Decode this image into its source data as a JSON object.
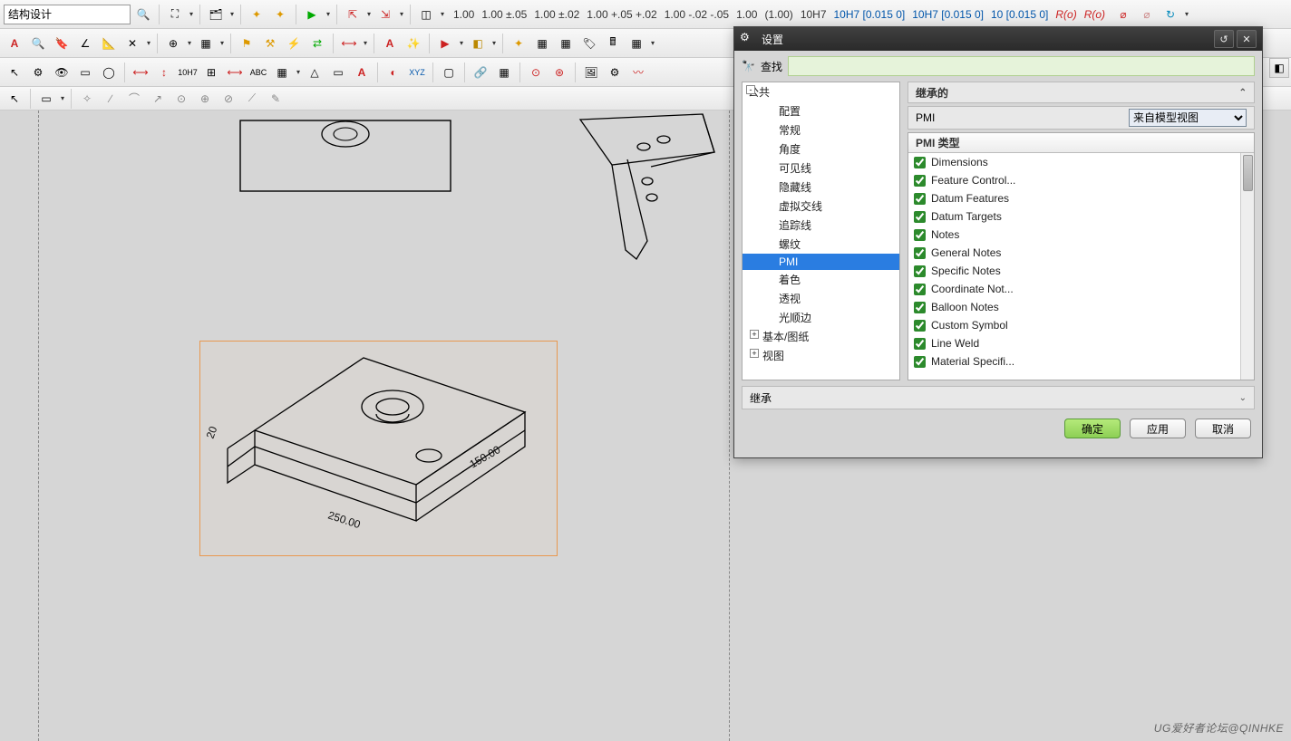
{
  "search_box": "结构设计",
  "toolbar1_labels": [
    "1.00",
    "1.00 ±.05",
    "1.00 ±.02",
    "1.00 +.05 +.02",
    "1.00 -.02 -.05",
    "1.00",
    "(1.00)",
    "10H7",
    "10H7 [0.015 0]",
    "10H7 [0.015 0]",
    "10 [0.015 0]",
    "R(o)",
    "R(o)"
  ],
  "dialog": {
    "title": "设置",
    "search_label": "查找",
    "search_value": "",
    "tree": [
      {
        "label": "公共",
        "depth": 0,
        "pm": "-"
      },
      {
        "label": "配置",
        "depth": 2
      },
      {
        "label": "常规",
        "depth": 2
      },
      {
        "label": "角度",
        "depth": 2
      },
      {
        "label": "可见线",
        "depth": 2
      },
      {
        "label": "隐藏线",
        "depth": 2
      },
      {
        "label": "虚拟交线",
        "depth": 2
      },
      {
        "label": "追踪线",
        "depth": 2
      },
      {
        "label": "螺纹",
        "depth": 2
      },
      {
        "label": "PMI",
        "depth": 2,
        "sel": true
      },
      {
        "label": "着色",
        "depth": 2
      },
      {
        "label": "透视",
        "depth": 2
      },
      {
        "label": "光顺边",
        "depth": 2
      },
      {
        "label": "基本/图纸",
        "depth": 1,
        "pm": "+"
      },
      {
        "label": "视图",
        "depth": 1,
        "pm": "+"
      }
    ],
    "inherited_header": "继承的",
    "pmi_label": "PMI",
    "pmi_source": "来自模型视图",
    "pmi_type_header": "PMI 类型",
    "pmi_types": [
      {
        "label": "Dimensions",
        "checked": true
      },
      {
        "label": "Feature Control...",
        "checked": true
      },
      {
        "label": "Datum Features",
        "checked": true
      },
      {
        "label": "Datum Targets",
        "checked": true
      },
      {
        "label": "Notes",
        "checked": true
      },
      {
        "label": "General Notes",
        "checked": true
      },
      {
        "label": "Specific Notes",
        "checked": true
      },
      {
        "label": "Coordinate Not...",
        "checked": true
      },
      {
        "label": "Balloon Notes",
        "checked": true
      },
      {
        "label": "Custom Symbol",
        "checked": true
      },
      {
        "label": "Line Weld",
        "checked": true
      },
      {
        "label": "Material Specifi...",
        "checked": true
      }
    ],
    "inherit_label": "继承",
    "buttons": {
      "ok": "确定",
      "apply": "应用",
      "cancel": "取消"
    }
  },
  "watermark": "UG爱好者论坛@QINHKE"
}
